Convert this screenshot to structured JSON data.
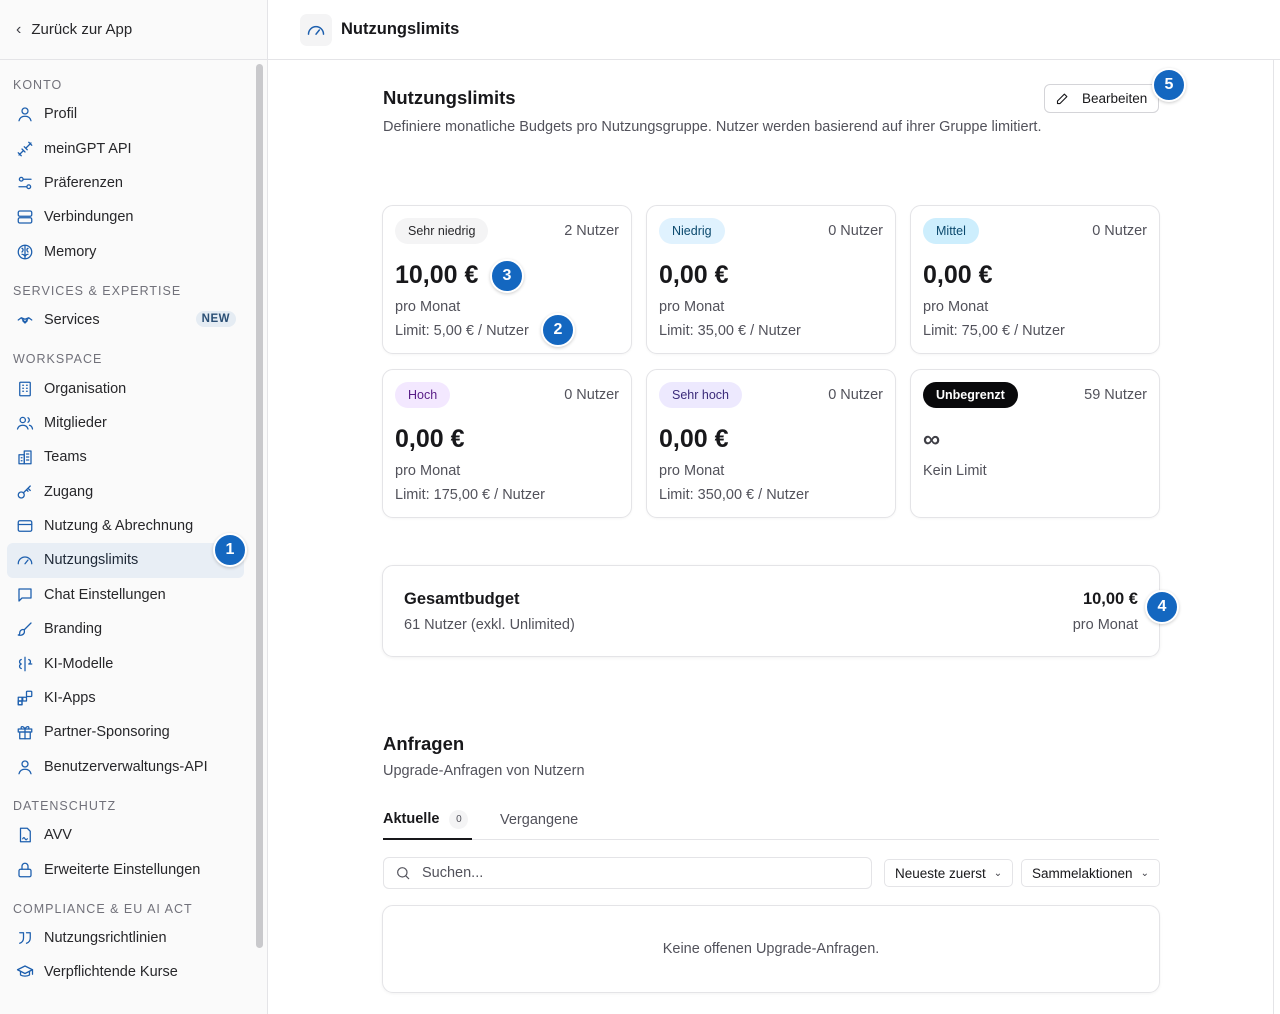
{
  "sidebar": {
    "back_label": "Zurück zur App",
    "sections": [
      {
        "title": "KONTO",
        "items": [
          {
            "label": "Profil",
            "icon": "user-icon"
          },
          {
            "label": "meinGPT API",
            "icon": "api-plug-icon"
          },
          {
            "label": "Präferenzen",
            "icon": "sliders-icon"
          },
          {
            "label": "Verbindungen",
            "icon": "server-icon"
          },
          {
            "label": "Memory",
            "icon": "brain-icon"
          }
        ]
      },
      {
        "title": "SERVICES & EXPERTISE",
        "items": [
          {
            "label": "Services",
            "icon": "handshake-icon",
            "badge": "NEW"
          }
        ]
      },
      {
        "title": "WORKSPACE",
        "items": [
          {
            "label": "Organisation",
            "icon": "building-icon"
          },
          {
            "label": "Mitglieder",
            "icon": "users-icon"
          },
          {
            "label": "Teams",
            "icon": "teams-icon"
          },
          {
            "label": "Zugang",
            "icon": "key-icon"
          },
          {
            "label": "Nutzung & Abrechnung",
            "icon": "credit-card-icon"
          },
          {
            "label": "Nutzungslimits",
            "icon": "gauge-icon",
            "active": true
          },
          {
            "label": "Chat Einstellungen",
            "icon": "chat-icon"
          },
          {
            "label": "Branding",
            "icon": "brush-icon"
          },
          {
            "label": "KI-Modelle",
            "icon": "ai-model-icon"
          },
          {
            "label": "KI-Apps",
            "icon": "apps-icon"
          },
          {
            "label": "Partner-Sponsoring",
            "icon": "gift-icon"
          },
          {
            "label": "Benutzerverwaltungs-API",
            "icon": "user-api-icon"
          }
        ]
      },
      {
        "title": "DATENSCHUTZ",
        "items": [
          {
            "label": "AVV",
            "icon": "document-sign-icon"
          },
          {
            "label": "Erweiterte Einstellungen",
            "icon": "lock-icon"
          }
        ]
      },
      {
        "title": "COMPLIANCE & EU AI ACT",
        "items": [
          {
            "label": "Nutzungsrichtlinien",
            "icon": "quote-icon"
          },
          {
            "label": "Verpflichtende Kurse",
            "icon": "graduation-cap-icon"
          }
        ]
      }
    ]
  },
  "header": {
    "title": "Nutzungslimits",
    "icon": "gauge-icon"
  },
  "limits": {
    "title": "Nutzungslimits",
    "description": "Definiere monatliche Budgets pro Nutzungsgruppe. Nutzer werden basierend auf ihrer Gruppe limitiert.",
    "edit_label": "Bearbeiten",
    "cards": [
      {
        "tier": "Sehr niedrig",
        "users": "2 Nutzer",
        "amount": "10,00 €",
        "per": "pro Monat",
        "limit": "Limit: 5,00 € / Nutzer",
        "color": "#f4f4f5"
      },
      {
        "tier": "Niedrig",
        "users": "0 Nutzer",
        "amount": "0,00 €",
        "per": "pro Monat",
        "limit": "Limit: 35,00 € / Nutzer",
        "color": "#e0f2fe"
      },
      {
        "tier": "Mittel",
        "users": "0 Nutzer",
        "amount": "0,00 €",
        "per": "pro Monat",
        "limit": "Limit: 75,00 € / Nutzer",
        "color": "#cdeefd"
      },
      {
        "tier": "Hoch",
        "users": "0 Nutzer",
        "amount": "0,00 €",
        "per": "pro Monat",
        "limit": "Limit: 175,00 € / Nutzer",
        "color": "#f3e8ff"
      },
      {
        "tier": "Sehr hoch",
        "users": "0 Nutzer",
        "amount": "0,00 €",
        "per": "pro Monat",
        "limit": "Limit: 350,00 € / Nutzer",
        "color": "#ede9fe"
      },
      {
        "tier": "Unbegrenzt",
        "users": "59 Nutzer",
        "amount": "∞",
        "per": "Kein Limit",
        "color": "#09090b"
      }
    ]
  },
  "total": {
    "title": "Gesamtbudget",
    "subtitle": "61 Nutzer (exkl. Unlimited)",
    "amount": "10,00 €",
    "per": "pro Monat"
  },
  "requests": {
    "title": "Anfragen",
    "subtitle": "Upgrade-Anfragen von Nutzern",
    "tabs": [
      {
        "label": "Aktuelle",
        "count": "0"
      },
      {
        "label": "Vergangene"
      }
    ],
    "search_placeholder": "Suchen...",
    "sort_label": "Neueste zuerst",
    "bulk_label": "Sammelaktionen",
    "empty_text": "Keine offenen Upgrade-Anfragen."
  },
  "markers": [
    "1",
    "2",
    "3",
    "4",
    "5"
  ]
}
